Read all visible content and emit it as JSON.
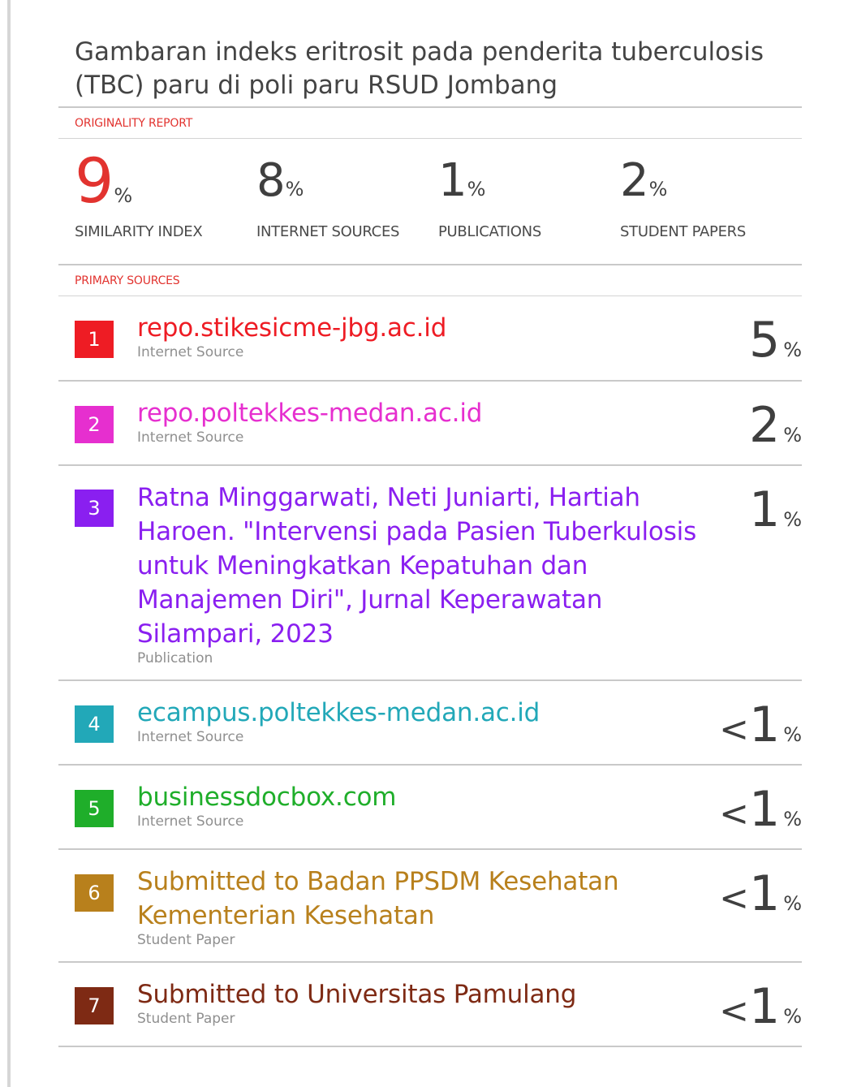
{
  "document": {
    "title": "Gambaran indeks eritrosit pada penderita tuberculosis (TBC) paru di poli paru RSUD Jombang"
  },
  "originality_label": "ORIGINALITY REPORT",
  "stats": [
    {
      "value": "9",
      "unit": "%",
      "label": "SIMILARITY INDEX"
    },
    {
      "value": "8",
      "unit": "%",
      "label": "INTERNET SOURCES"
    },
    {
      "value": "1",
      "unit": "%",
      "label": "PUBLICATIONS"
    },
    {
      "value": "2",
      "unit": "%",
      "label": "STUDENT PAPERS"
    }
  ],
  "primary_sources_label": "PRIMARY SOURCES",
  "sources": [
    {
      "rank": "1",
      "name": "repo.stikesicme-jbg.ac.id",
      "type": "Internet Source",
      "prefix": "",
      "pct": "5",
      "unit": "%",
      "color": "#ee1c24"
    },
    {
      "rank": "2",
      "name": "repo.poltekkes-medan.ac.id",
      "type": "Internet Source",
      "prefix": "",
      "pct": "2",
      "unit": "%",
      "color": "#e62fcf"
    },
    {
      "rank": "3",
      "name": "Ratna Minggarwati, Neti Juniarti, Hartiah Haroen. \"Intervensi pada Pasien Tuberkulosis untuk Meningkatkan Kepatuhan dan Manajemen Diri\", Jurnal Keperawatan Silampari, 2023",
      "type": "Publication",
      "prefix": "",
      "pct": "1",
      "unit": "%",
      "color": "#8a1ff0"
    },
    {
      "rank": "4",
      "name": "ecampus.poltekkes-medan.ac.id",
      "type": "Internet Source",
      "prefix": "<",
      "pct": "1",
      "unit": "%",
      "color": "#22a8b8"
    },
    {
      "rank": "5",
      "name": "businessdocbox.com",
      "type": "Internet Source",
      "prefix": "<",
      "pct": "1",
      "unit": "%",
      "color": "#1fae2a"
    },
    {
      "rank": "6",
      "name": "Submitted to Badan PPSDM Kesehatan Kementerian Kesehatan",
      "type": "Student Paper",
      "prefix": "<",
      "pct": "1",
      "unit": "%",
      "color": "#b8801c"
    },
    {
      "rank": "7",
      "name": "Submitted to Universitas Pamulang",
      "type": "Student Paper",
      "prefix": "<",
      "pct": "1",
      "unit": "%",
      "color": "#7e2a14"
    }
  ]
}
